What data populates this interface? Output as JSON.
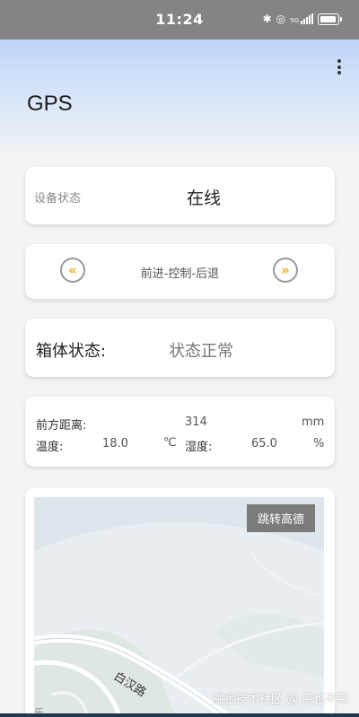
{
  "status_bar": {
    "time": "11:24",
    "icons": [
      "bluetooth-icon",
      "hotspot-icon",
      "signal-5g-icon",
      "battery-icon"
    ],
    "network": "5G"
  },
  "header": {
    "title": "GPS",
    "menu_icon": "more-vertical-icon"
  },
  "device_status": {
    "label": "设备状态",
    "value": "在线"
  },
  "control": {
    "left_icon": "chevrons-left-icon",
    "left_glyph": "«",
    "label": "前进-控制-后退",
    "right_icon": "chevrons-right-icon",
    "right_glyph": "»",
    "accent": "#e8b21a"
  },
  "box_status": {
    "label": "箱体状态:",
    "value": "状态正常"
  },
  "sensors": {
    "distance_label": "前方距离:",
    "distance_value": "314",
    "distance_unit": "mm",
    "temp_label": "温度:",
    "temp_value": "18.0",
    "temp_unit": "℃",
    "humidity_label": "湿度:",
    "humidity_value": "65.0",
    "humidity_unit": "%"
  },
  "map": {
    "jump_label": "跳转高德",
    "road_label": "白汉路",
    "corner_label": "乐"
  },
  "watermark": "掘金技术社区 @ 离也不离"
}
